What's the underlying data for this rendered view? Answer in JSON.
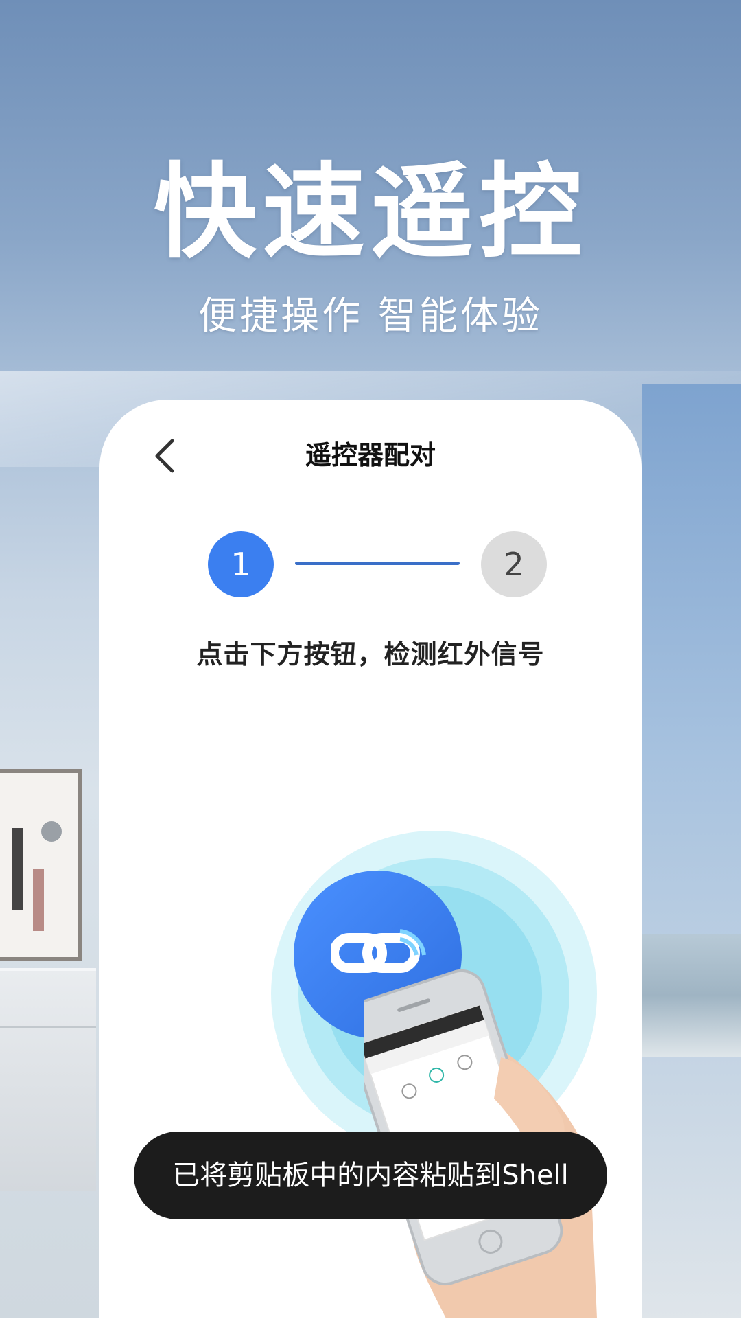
{
  "hero": {
    "title": "快速遥控",
    "subtitle": "便捷操作 智能体验"
  },
  "pairing_screen": {
    "title": "遥控器配对",
    "back_icon": "chevron-left-icon",
    "steps": [
      {
        "label": "1",
        "state": "active",
        "color": "#3b7ff0"
      },
      {
        "label": "2",
        "state": "inactive",
        "color": "#dcdcdc"
      }
    ],
    "instruction": "点击下方按钮，检测红外信号",
    "pair_button_icon": "link-signal-icon"
  },
  "toast": {
    "message": "已将剪贴板中的内容粘贴到Shell"
  },
  "colors": {
    "accent": "#3b7ff0",
    "toast_bg": "#1c1c1c"
  }
}
